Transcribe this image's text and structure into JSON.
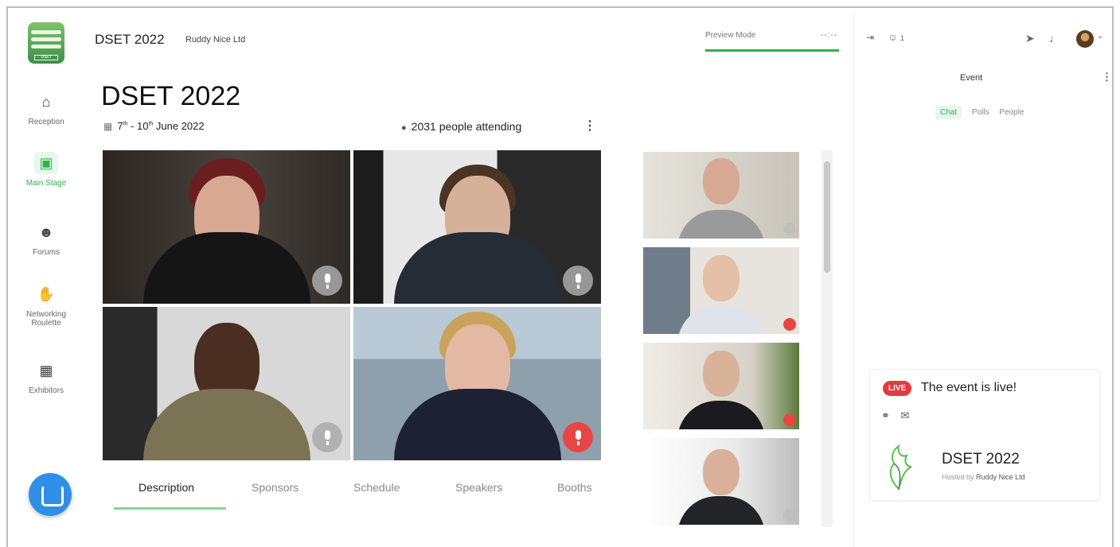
{
  "sidebar": {
    "logo_label": "DSET",
    "items": [
      {
        "label": "Reception",
        "icon": "home-icon",
        "active": false
      },
      {
        "label": "Main Stage",
        "icon": "video-camera-icon",
        "active": true
      },
      {
        "label": "Forums",
        "icon": "group-icon",
        "active": false
      },
      {
        "label": "Networking Roulette",
        "icon": "handshake-icon",
        "active": false
      },
      {
        "label": "Exhibitors",
        "icon": "booth-icon",
        "active": false
      }
    ]
  },
  "topbar": {
    "title": "DSET 2022",
    "organization": "Ruddy Nice Ltd",
    "preview_mode": "Preview Mode",
    "timer": "--:--"
  },
  "event": {
    "title": "DSET 2022",
    "date_start": "7",
    "date_start_sup": "th",
    "date_end": " - 10",
    "date_end_sup": "th",
    "date_month": " June 2022",
    "attending": "2031 people attending"
  },
  "tabs": [
    "Description",
    "Sponsors",
    "Schedule",
    "Speakers",
    "Booths"
  ],
  "right_panel": {
    "attendee_count": "1",
    "section_title": "Event",
    "tabs": [
      "Chat",
      "Polls",
      "People"
    ],
    "live_badge": "LIVE",
    "live_text": "The event is live!",
    "host_event": "DSET 2022",
    "hosted_by_prefix": "Hosted by",
    "hosted_by_name": "Ruddy Nice Ltd"
  },
  "colors": {
    "accent": "#2fb24e",
    "live": "#e33b3b",
    "chat_button": "#2f8fe6"
  }
}
